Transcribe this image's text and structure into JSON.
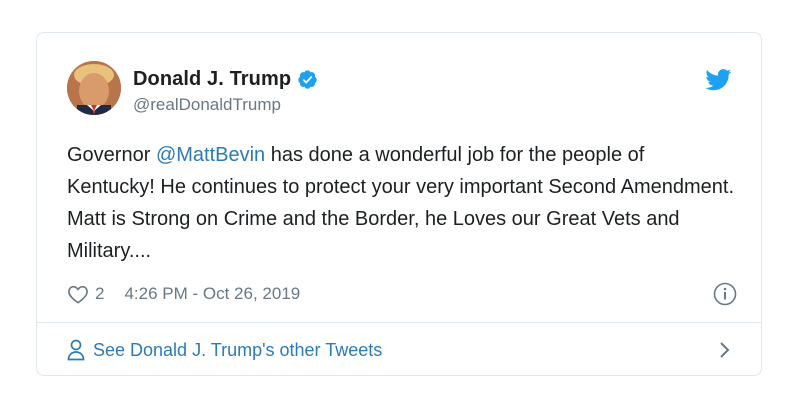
{
  "tweet": {
    "author": {
      "display_name": "Donald J. Trump",
      "handle": "@realDonaldTrump",
      "verified": true
    },
    "text": {
      "before_mention": "Governor ",
      "mention": "@MattBevin",
      "after_mention": " has done a wonderful job for the people of Kentucky! He continues to protect your very important Second Amendment. Matt is Strong on Crime and the Border, he Loves our Great Vets and Military...."
    },
    "likes": "2",
    "timestamp": "4:26 PM - Oct 26, 2019",
    "footer_link": "See Donald J. Trump's other Tweets"
  },
  "colors": {
    "link_blue": "#2b7bb9",
    "twitter_blue": "#1da1f2",
    "muted_gray": "#697882",
    "border": "#e1e8ed"
  },
  "icons": [
    "verified-badge-icon",
    "twitter-bird-icon",
    "heart-icon",
    "info-icon",
    "person-icon",
    "chevron-right-icon"
  ]
}
